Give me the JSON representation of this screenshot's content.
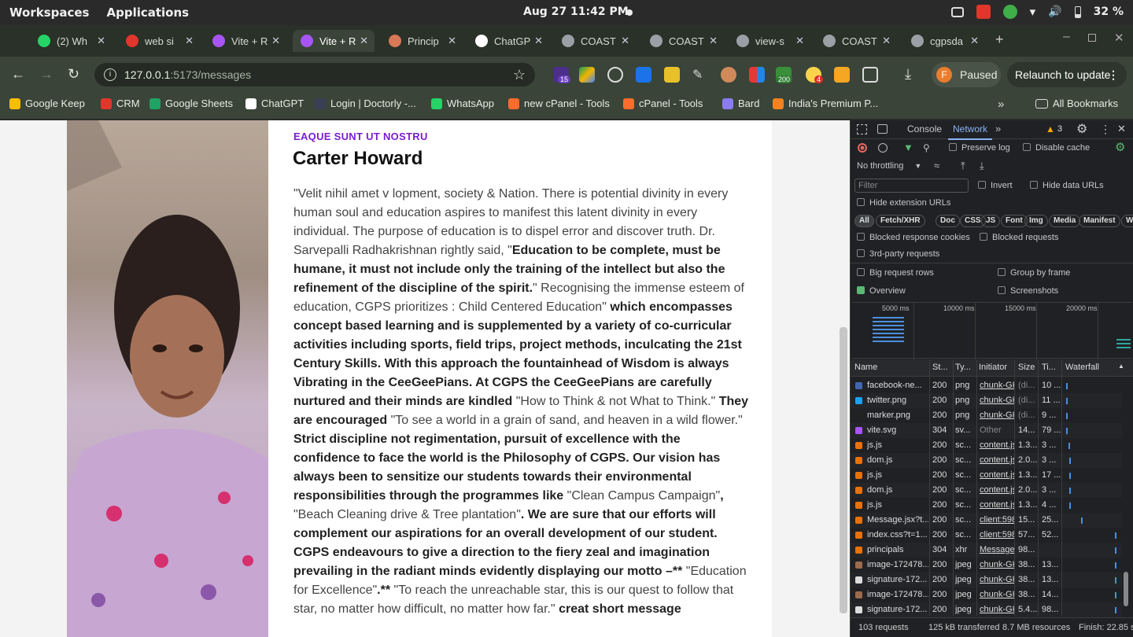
{
  "system": {
    "workspaces": "Workspaces",
    "applications": "Applications",
    "clock": "Aug 27  11:42 PM",
    "battery": "32 %"
  },
  "tabs": [
    {
      "label": "(2) Wh",
      "color": "#25d366"
    },
    {
      "label": "web si",
      "color": "#e0362b"
    },
    {
      "label": "Vite + R",
      "color": "#a855f7"
    },
    {
      "label": "Vite + R",
      "color": "#a855f7"
    },
    {
      "label": "Princip",
      "color": "#d97757"
    },
    {
      "label": "ChatGP",
      "color": "#ffffff"
    },
    {
      "label": "COAST",
      "color": "#9aa0a6"
    },
    {
      "label": "COAST",
      "color": "#9aa0a6"
    },
    {
      "label": "view-s",
      "color": "#9aa0a6"
    },
    {
      "label": "COAST",
      "color": "#9aa0a6"
    },
    {
      "label": "cgpsda",
      "color": "#9aa0a6"
    }
  ],
  "address": {
    "host": "127.0.0.1",
    "path": ":5173/messages"
  },
  "extensions": {
    "badge1": "15",
    "badge2": "200",
    "badge3": "4"
  },
  "paused": {
    "avatar": "F",
    "label": "Paused"
  },
  "relaunch": "Relaunch to update",
  "bookmarks": [
    {
      "label": "Google Keep",
      "color": "#fbbc04"
    },
    {
      "label": "CRM",
      "color": "#e0362b"
    },
    {
      "label": "Google Sheets",
      "color": "#1ea362"
    },
    {
      "label": "ChatGPT",
      "color": "#ffffff"
    },
    {
      "label": "Login | Doctorly -...",
      "color": "#3a3f55"
    },
    {
      "label": "WhatsApp",
      "color": "#25d366"
    },
    {
      "label": "new cPanel - Tools",
      "color": "#ff6c2c"
    },
    {
      "label": "cPanel - Tools",
      "color": "#ff6c2c"
    },
    {
      "label": "Bard",
      "color": "#8a7cf0"
    },
    {
      "label": "India's Premium P...",
      "color": "#f58220"
    }
  ],
  "all_bookmarks": "All Bookmarks",
  "message": {
    "eyebrow": "EAQUE SUNT UT NOSTRU",
    "name": "Carter Howard",
    "segments": [
      {
        "t": "\"Velit nihil amet v lopment, society & Nation. There is potential divinity in every human soul and education aspires to manifest this latent divinity in every individual. The purpose of education is to dispel error and discover truth. Dr. Sarvepalli Radhakrishnan rightly said, \"",
        "b": false
      },
      {
        "t": "Education to be complete, must be humane, it must not include only the training of the intellect but also the refinement of the discipline of the spirit.",
        "b": true
      },
      {
        "t": "\" Recognising the immense esteem of education, CGPS prioritizes : Child Centered Education\" ",
        "b": false
      },
      {
        "t": "which encompasses concept based learning and is supplemented by a variety of co-curricular activities including sports, field trips, project methods, inculcating the 21st Century Skills. With this approach the fountainhead of Wisdom is always Vibrating in the CeeGeePians. At CGPS the CeeGeePians are carefully nurtured and their minds are kindled",
        "b": true
      },
      {
        "t": " \"How to Think & not What to Think.\" ",
        "b": false
      },
      {
        "t": "They are encouraged",
        "b": true
      },
      {
        "t": " \"To see a world in a grain of sand, and heaven in a wild flower.\" ",
        "b": false
      },
      {
        "t": "Strict discipline not regimentation, pursuit of excellence with the confidence to face the world is the Philosophy of CGPS. Our vision has always been to sensitize our students towards their environmental responsibilities through the programmes like",
        "b": true
      },
      {
        "t": " \"Clean Campus Campaign\"",
        "b": false
      },
      {
        "t": ", ",
        "b": true
      },
      {
        "t": "\"Beach Cleaning drive & Tree plantation\"",
        "b": false
      },
      {
        "t": ". We are sure that our efforts will complement our aspirations for an overall development of our student. CGPS endeavours to give a direction to the fiery zeal and imagination prevailing in the radiant minds evidently displaying our motto –**",
        "b": true
      },
      {
        "t": " \"Education for Excellence\"",
        "b": false
      },
      {
        "t": ".**",
        "b": true
      },
      {
        "t": " \"To reach the unreachable star, this is our quest to follow that star, no matter how difficult, no matter how far.\" ",
        "b": false
      },
      {
        "t": "creat short message",
        "b": true
      }
    ]
  },
  "devtools": {
    "tabs": [
      "Console",
      "Network"
    ],
    "issues": "3",
    "preserve_log": "Preserve log",
    "disable_cache": "Disable cache",
    "throttling": "No throttling",
    "filter_placeholder": "Filter",
    "invert": "Invert",
    "hide_data_urls": "Hide data URLs",
    "hide_ext_urls": "Hide extension URLs",
    "chips": [
      "All",
      "Fetch/XHR",
      "Doc",
      "CSS",
      "JS",
      "Font",
      "Img",
      "Media",
      "Manifest",
      "WS"
    ],
    "blocked_cookies": "Blocked response cookies",
    "blocked_requests": "Blocked requests",
    "third_party": "3rd-party requests",
    "big_rows": "Big request rows",
    "group_frame": "Group by frame",
    "overview": "Overview",
    "screenshots": "Screenshots",
    "ticks": [
      "5000 ms",
      "10000 ms",
      "15000 ms",
      "20000 ms"
    ],
    "columns": [
      "Name",
      "St...",
      "Ty...",
      "Initiator",
      "Size",
      "Ti...",
      "Waterfall"
    ],
    "rows": [
      {
        "name": "facebook-ne...",
        "status": "200",
        "type": "png",
        "init": "chunk-GK",
        "size": "(di...",
        "time": "10 ...",
        "color": "#4267b2",
        "wf": 0.02
      },
      {
        "name": "twitter.png",
        "status": "200",
        "type": "png",
        "init": "chunk-GK",
        "size": "(di...",
        "time": "11 ...",
        "color": "#1da1f2",
        "wf": 0.02
      },
      {
        "name": "marker.png",
        "status": "200",
        "type": "png",
        "init": "chunk-GK",
        "size": "(di...",
        "time": "9 ...",
        "color": "#222222",
        "wf": 0.02
      },
      {
        "name": "vite.svg",
        "status": "304",
        "type": "sv...",
        "init": "Other",
        "size": "14...",
        "time": "79 ...",
        "color": "#a855f7",
        "wf": 0.02
      },
      {
        "name": "js.js",
        "status": "200",
        "type": "sc...",
        "init": "content.js",
        "size": "1.3...",
        "time": "3 ...",
        "color": "#e8710a",
        "wf": 0.06
      },
      {
        "name": "dom.js",
        "status": "200",
        "type": "sc...",
        "init": "content.js",
        "size": "2.0...",
        "time": "3 ...",
        "color": "#e8710a",
        "wf": 0.08
      },
      {
        "name": "js.js",
        "status": "200",
        "type": "sc...",
        "init": "content.js",
        "size": "1.3...",
        "time": "17 ...",
        "color": "#e8710a",
        "wf": 0.08
      },
      {
        "name": "dom.js",
        "status": "200",
        "type": "sc...",
        "init": "content.js",
        "size": "2.0...",
        "time": "3 ...",
        "color": "#e8710a",
        "wf": 0.08
      },
      {
        "name": "js.js",
        "status": "200",
        "type": "sc...",
        "init": "content.js",
        "size": "1.3...",
        "time": "4 ...",
        "color": "#e8710a",
        "wf": 0.08
      },
      {
        "name": "Message.jsx?t...",
        "status": "200",
        "type": "sc...",
        "init": "client:598",
        "size": "15...",
        "time": "25...",
        "color": "#e8710a",
        "wf": 0.3
      },
      {
        "name": "index.css?t=1...",
        "status": "200",
        "type": "sc...",
        "init": "client:598",
        "size": "57...",
        "time": "52...",
        "color": "#e8710a",
        "wf": 0.96
      },
      {
        "name": "principals",
        "status": "304",
        "type": "xhr",
        "init": "Message.",
        "size": "98...",
        "time": "",
        "color": "#e8710a",
        "wf": 0.96
      },
      {
        "name": "image-172478...",
        "status": "200",
        "type": "jpeg",
        "init": "chunk-GK",
        "size": "38...",
        "time": "13...",
        "color": "#9c6b4e",
        "wf": 0.96
      },
      {
        "name": "signature-172...",
        "status": "200",
        "type": "jpeg",
        "init": "chunk-GK",
        "size": "38...",
        "time": "13...",
        "color": "#dddddd",
        "wf": 0.96
      },
      {
        "name": "image-172478...",
        "status": "200",
        "type": "jpeg",
        "init": "chunk-GK",
        "size": "38...",
        "time": "14...",
        "color": "#9c6b4e",
        "wf": 0.96
      },
      {
        "name": "signature-172...",
        "status": "200",
        "type": "jpeg",
        "init": "chunk-GK",
        "size": "5.4...",
        "time": "98...",
        "color": "#dddddd",
        "wf": 0.96
      }
    ],
    "status": {
      "requests": "103 requests",
      "transferred": "125 kB transferred",
      "resources": "8.7 MB resources",
      "finish": "Finish: 22.85 s"
    }
  }
}
